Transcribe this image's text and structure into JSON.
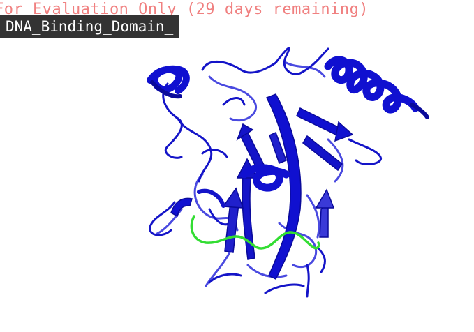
{
  "watermark": {
    "text": "For Evaluation Only (29 days remaining)",
    "color": "#f08080"
  },
  "object_label": {
    "text": "DNA_Binding_Domain_"
  },
  "colors": {
    "background": "#ffffff",
    "protein": "#1010d0",
    "protein_dark": "#0a0a9a",
    "protein_light": "#4a4ae0",
    "dna_strand": "#33dd33"
  },
  "structure": {
    "representation": "cartoon",
    "chains": [
      {
        "name": "protein",
        "color": "#1010d0"
      },
      {
        "name": "dna",
        "color": "#33dd33"
      }
    ]
  }
}
